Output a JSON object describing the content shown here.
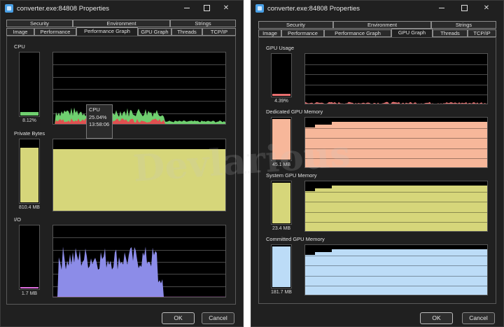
{
  "left_window": {
    "title": "converter.exe:84808 Properties",
    "tabs_row1": [
      "Security",
      "Environment",
      "Strings"
    ],
    "tabs_row2": [
      "Image",
      "Performance",
      "Performance Graph",
      "GPU Graph",
      "Threads",
      "TCP/IP"
    ],
    "active_tab": "Performance Graph",
    "sections": [
      {
        "label": "CPU",
        "meter_value": "8.12%",
        "meter_level_pct": 8.12
      },
      {
        "label": "Private Bytes",
        "meter_value": "810.4 MB",
        "meter_level_pct": 92
      },
      {
        "label": "I/O",
        "meter_value": "1.7 MB",
        "meter_level_pct": 2
      }
    ],
    "tooltip": {
      "name": "CPU",
      "value": "25.04%",
      "time": "13:58:06"
    },
    "ok_label": "OK",
    "cancel_label": "Cancel"
  },
  "right_window": {
    "title": "converter.exe:84808 Properties",
    "tabs_row1": [
      "Security",
      "Environment",
      "Strings"
    ],
    "tabs_row2": [
      "Image",
      "Performance",
      "Performance Graph",
      "GPU Graph",
      "Threads",
      "TCP/IP"
    ],
    "active_tab": "GPU Graph",
    "sections": [
      {
        "label": "GPU Usage",
        "meter_value": "4.39%",
        "meter_level_pct": 4.39
      },
      {
        "label": "Dedicated GPU Memory",
        "meter_value": "45.1 MB",
        "meter_level_pct": 95
      },
      {
        "label": "System GPU Memory",
        "meter_value": "23.4 MB",
        "meter_level_pct": 95
      },
      {
        "label": "Committed GPU Memory",
        "meter_value": "181.7 MB",
        "meter_level_pct": 95
      }
    ],
    "ok_label": "OK",
    "cancel_label": "Cancel"
  },
  "watermark_text": "Devlarious",
  "colors": {
    "cpu_green": "#6fcf6f",
    "cpu_red": "#e05050",
    "memory_yellow": "#d6d67a",
    "io_blue": "#8c8ce8",
    "io_pink": "#e070e0",
    "gpu_usage_red": "#e87070",
    "dedicated_orange": "#f7b79a",
    "system_yellow": "#d6d67a",
    "committed_blue": "#bcdcf7"
  }
}
